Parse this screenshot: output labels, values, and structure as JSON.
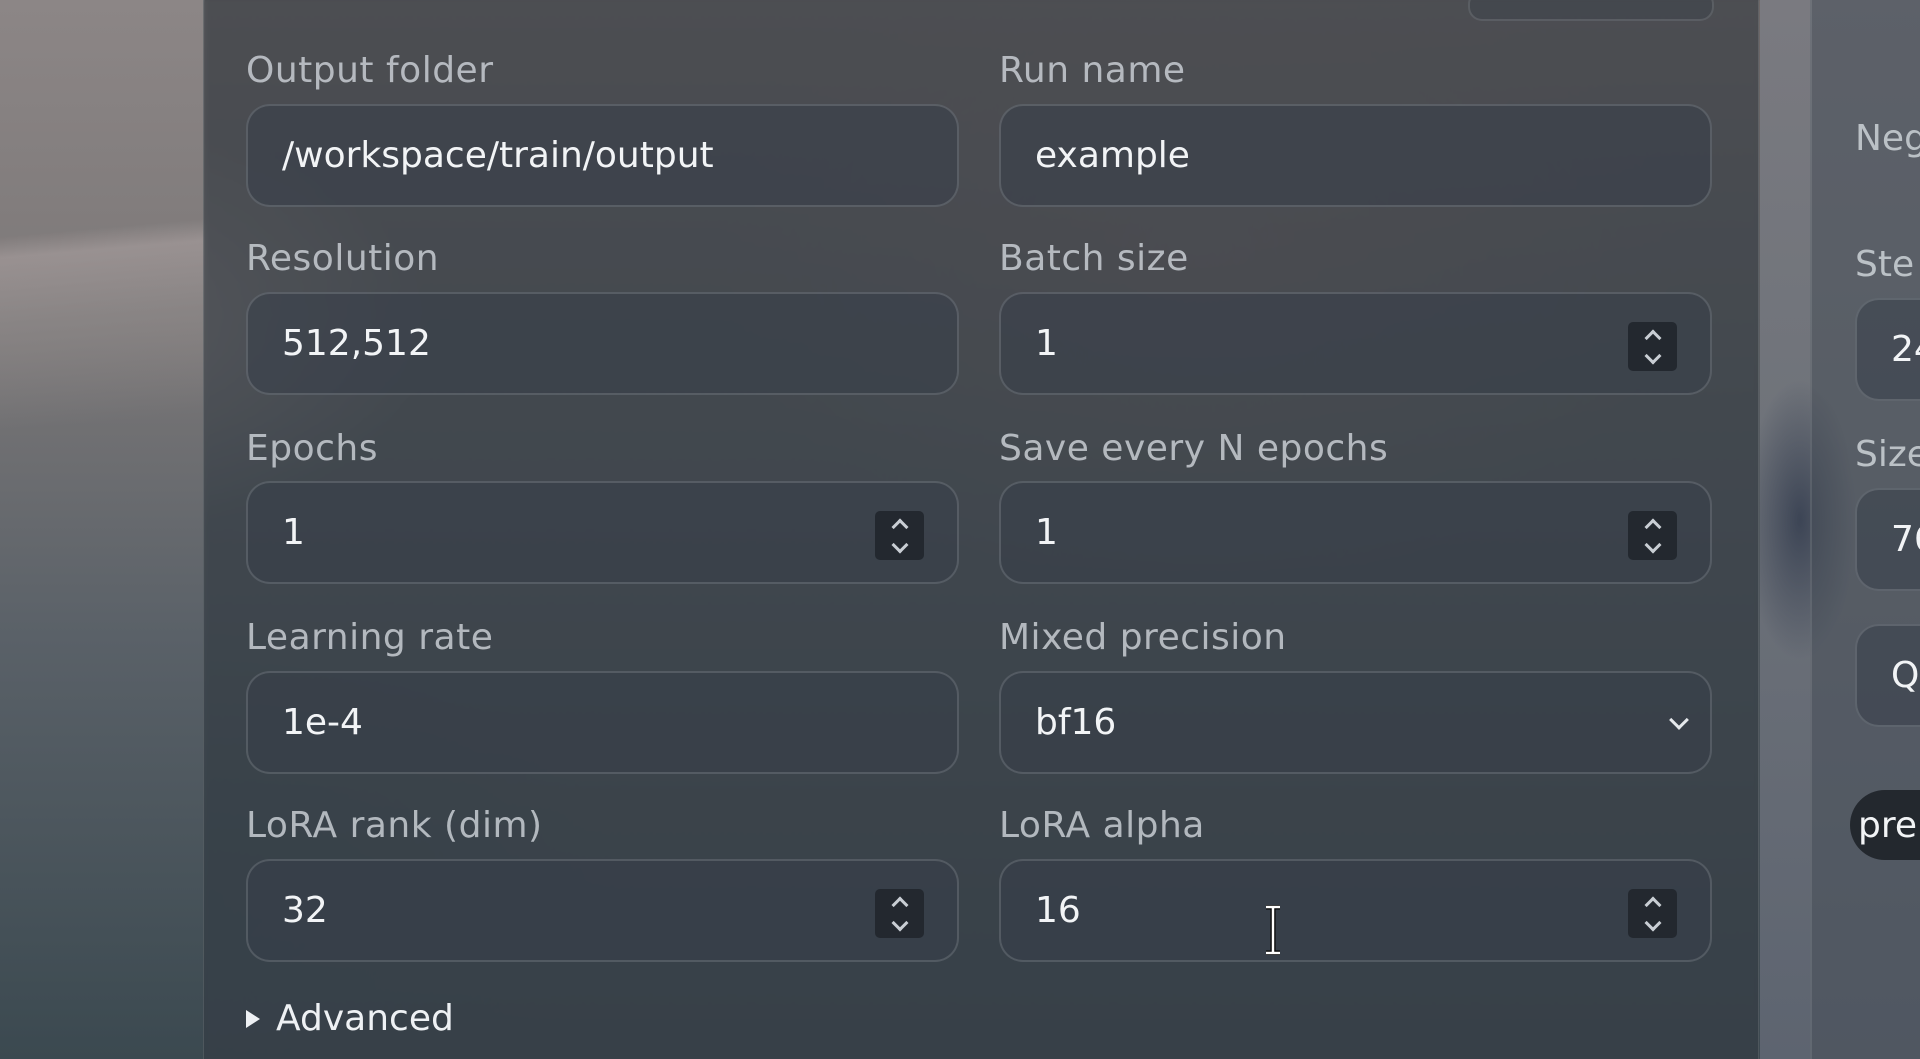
{
  "form": {
    "output_folder": {
      "label": "Output folder",
      "value": "/workspace/train/output"
    },
    "run_name": {
      "label": "Run name",
      "value": "example"
    },
    "resolution": {
      "label": "Resolution",
      "value": "512,512"
    },
    "batch_size": {
      "label": "Batch size",
      "value": "1"
    },
    "epochs": {
      "label": "Epochs",
      "value": "1"
    },
    "save_every": {
      "label": "Save every N epochs",
      "value": "1"
    },
    "learning_rate": {
      "label": "Learning rate",
      "value": "1e-4"
    },
    "mixed_precision": {
      "label": "Mixed precision",
      "value": "bf16"
    },
    "lora_rank": {
      "label": "LoRA rank (dim)",
      "value": "32"
    },
    "lora_alpha": {
      "label": "LoRA alpha",
      "value": "16"
    },
    "advanced": {
      "label": "Advanced"
    }
  },
  "side": {
    "negative_label": "Neg",
    "steps_label": "Ste",
    "steps_value": "24",
    "size_label": "Size",
    "size_value": "76",
    "q_box": "Q",
    "pill": "pre"
  }
}
